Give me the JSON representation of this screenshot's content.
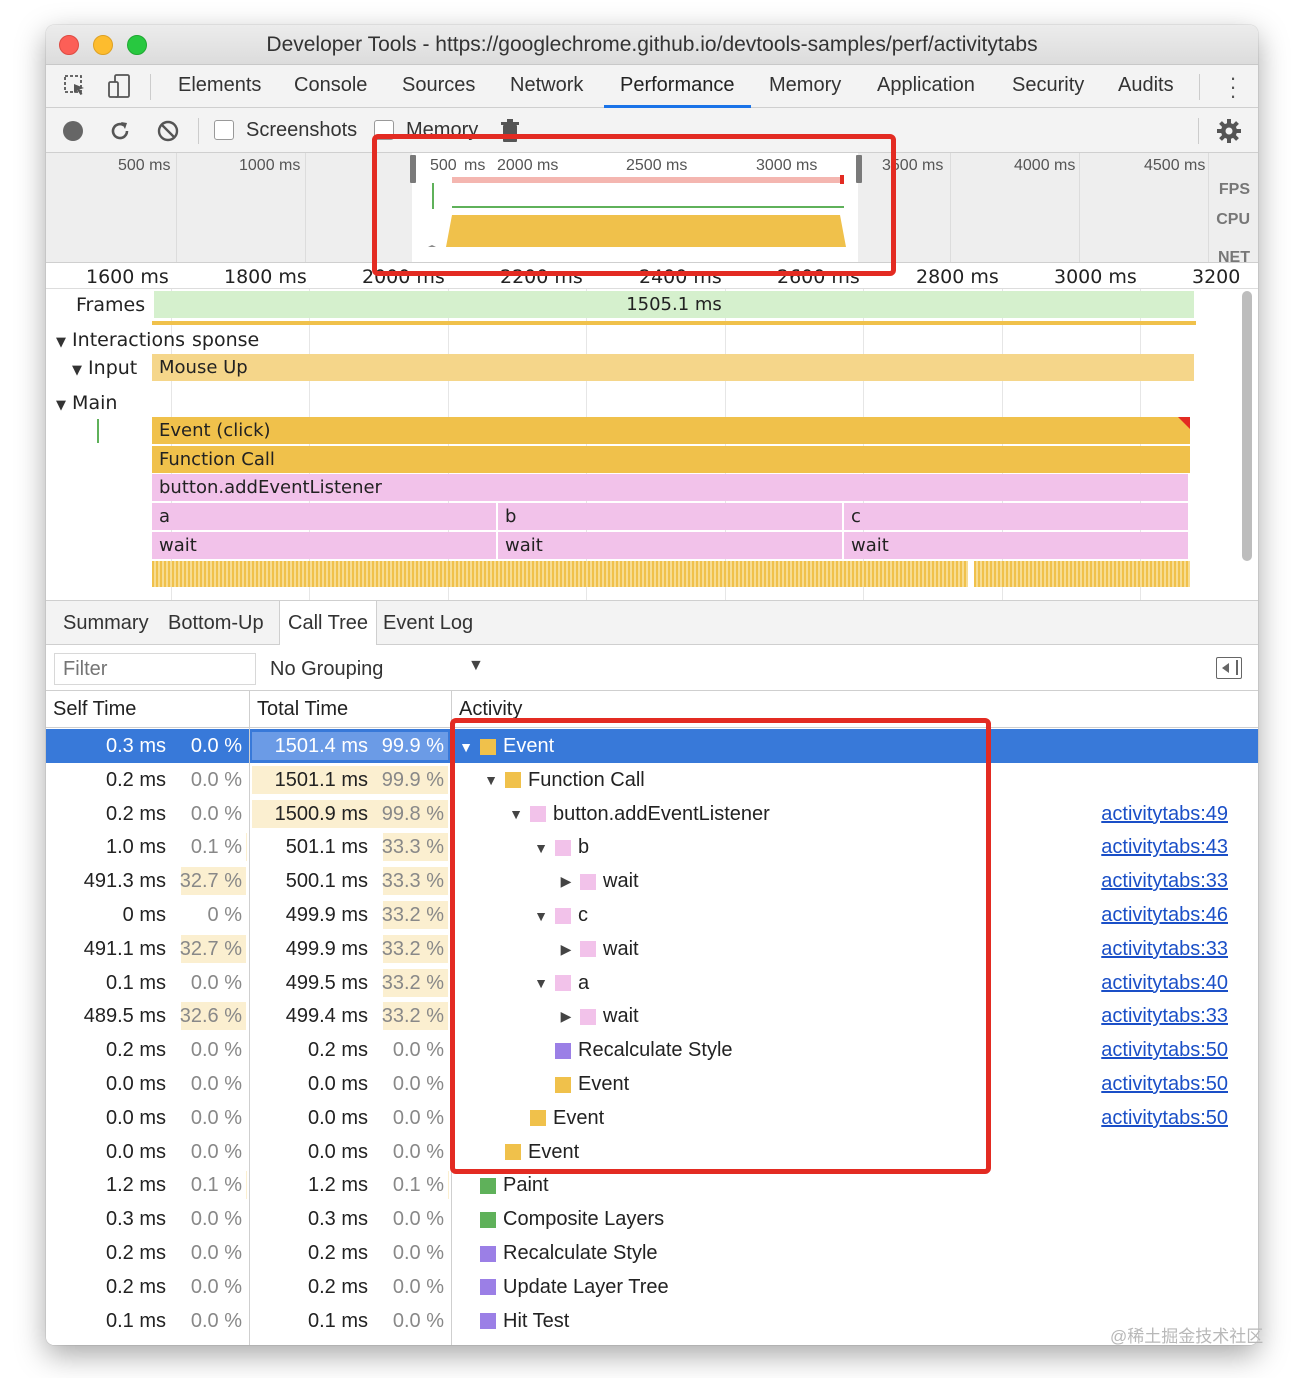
{
  "window": {
    "title": "Developer Tools - https://googlechrome.github.io/devtools-samples/perf/activitytabs"
  },
  "tabs": [
    "Elements",
    "Console",
    "Sources",
    "Network",
    "Performance",
    "Memory",
    "Application",
    "Security",
    "Audits"
  ],
  "active_tab": "Performance",
  "toolbar": {
    "screenshots_label": "Screenshots",
    "memory_label": "Memory"
  },
  "overview": {
    "ticks": [
      "500 ms",
      "1000 ms",
      "500",
      "ms",
      "2000 ms",
      "2500 ms",
      "3000 ms",
      "3500 ms",
      "4000 ms",
      "4500 ms"
    ],
    "labels": [
      "FPS",
      "CPU",
      "NET"
    ]
  },
  "flamechart": {
    "ticks": [
      "1600 ms",
      "1800 ms",
      "2000 ms",
      "2200 ms",
      "2400 ms",
      "2600 ms",
      "2800 ms",
      "3000 ms",
      "3200"
    ],
    "frames_label": "Frames",
    "frames_value": "1505.1 ms",
    "interactions_label": "Interactions",
    "interactions_overlap": "sponse",
    "input_label": "Input",
    "mouse_up": "Mouse Up",
    "main_label": "Main",
    "event_click": "Event (click)",
    "function_call": "Function Call",
    "add_listener": "button.addEventListener",
    "fn_a": "a",
    "fn_b": "b",
    "fn_c": "c",
    "wait": "wait"
  },
  "detail_tabs": [
    "Summary",
    "Bottom-Up",
    "Call Tree",
    "Event Log"
  ],
  "active_detail_tab": "Call Tree",
  "filter": {
    "placeholder": "Filter",
    "grouping": "No Grouping"
  },
  "columns": {
    "self": "Self Time",
    "total": "Total Time",
    "activity": "Activity"
  },
  "colors": {
    "scripting": "#f0c14b",
    "function": "#f2c2ea",
    "rendering": "#9b7fe6",
    "painting": "#5fb15a",
    "selection": "#3879d9"
  },
  "rows": [
    {
      "self_ms": "0.3 ms",
      "self_pct": "0.0 %",
      "self_bar": 0.0,
      "total_ms": "1501.4 ms",
      "total_pct": "99.9 %",
      "total_bar": 0.999,
      "depth": 0,
      "expander": "▼",
      "color": "#f0c14b",
      "name": "Event",
      "link": ""
    },
    {
      "self_ms": "0.2 ms",
      "self_pct": "0.0 %",
      "self_bar": 0.0,
      "total_ms": "1501.1 ms",
      "total_pct": "99.9 %",
      "total_bar": 0.999,
      "depth": 1,
      "expander": "▼",
      "color": "#f0c14b",
      "name": "Function Call",
      "link": ""
    },
    {
      "self_ms": "0.2 ms",
      "self_pct": "0.0 %",
      "self_bar": 0.0,
      "total_ms": "1500.9 ms",
      "total_pct": "99.8 %",
      "total_bar": 0.998,
      "depth": 2,
      "expander": "▼",
      "color": "#f2c2ea",
      "name": "button.addEventListener",
      "link": "activitytabs:49"
    },
    {
      "self_ms": "1.0 ms",
      "self_pct": "0.1 %",
      "self_bar": 0.001,
      "total_ms": "501.1 ms",
      "total_pct": "33.3 %",
      "total_bar": 0.333,
      "depth": 3,
      "expander": "▼",
      "color": "#f2c2ea",
      "name": "b",
      "link": "activitytabs:43"
    },
    {
      "self_ms": "491.3 ms",
      "self_pct": "32.7 %",
      "self_bar": 0.327,
      "total_ms": "500.1 ms",
      "total_pct": "33.3 %",
      "total_bar": 0.333,
      "depth": 4,
      "expander": "▶",
      "color": "#f2c2ea",
      "name": "wait",
      "link": "activitytabs:33"
    },
    {
      "self_ms": "0 ms",
      "self_pct": "0 %",
      "self_bar": 0.0,
      "total_ms": "499.9 ms",
      "total_pct": "33.2 %",
      "total_bar": 0.332,
      "depth": 3,
      "expander": "▼",
      "color": "#f2c2ea",
      "name": "c",
      "link": "activitytabs:46"
    },
    {
      "self_ms": "491.1 ms",
      "self_pct": "32.7 %",
      "self_bar": 0.327,
      "total_ms": "499.9 ms",
      "total_pct": "33.2 %",
      "total_bar": 0.332,
      "depth": 4,
      "expander": "▶",
      "color": "#f2c2ea",
      "name": "wait",
      "link": "activitytabs:33"
    },
    {
      "self_ms": "0.1 ms",
      "self_pct": "0.0 %",
      "self_bar": 0.0,
      "total_ms": "499.5 ms",
      "total_pct": "33.2 %",
      "total_bar": 0.332,
      "depth": 3,
      "expander": "▼",
      "color": "#f2c2ea",
      "name": "a",
      "link": "activitytabs:40"
    },
    {
      "self_ms": "489.5 ms",
      "self_pct": "32.6 %",
      "self_bar": 0.326,
      "total_ms": "499.4 ms",
      "total_pct": "33.2 %",
      "total_bar": 0.332,
      "depth": 4,
      "expander": "▶",
      "color": "#f2c2ea",
      "name": "wait",
      "link": "activitytabs:33"
    },
    {
      "self_ms": "0.2 ms",
      "self_pct": "0.0 %",
      "self_bar": 0.0,
      "total_ms": "0.2 ms",
      "total_pct": "0.0 %",
      "total_bar": 0.0,
      "depth": 3,
      "expander": "",
      "color": "#9b7fe6",
      "name": "Recalculate Style",
      "link": "activitytabs:50"
    },
    {
      "self_ms": "0.0 ms",
      "self_pct": "0.0 %",
      "self_bar": 0.0,
      "total_ms": "0.0 ms",
      "total_pct": "0.0 %",
      "total_bar": 0.0,
      "depth": 3,
      "expander": "",
      "color": "#f0c14b",
      "name": "Event",
      "link": "activitytabs:50"
    },
    {
      "self_ms": "0.0 ms",
      "self_pct": "0.0 %",
      "self_bar": 0.0,
      "total_ms": "0.0 ms",
      "total_pct": "0.0 %",
      "total_bar": 0.0,
      "depth": 2,
      "expander": "",
      "color": "#f0c14b",
      "name": "Event",
      "link": "activitytabs:50"
    },
    {
      "self_ms": "0.0 ms",
      "self_pct": "0.0 %",
      "self_bar": 0.0,
      "total_ms": "0.0 ms",
      "total_pct": "0.0 %",
      "total_bar": 0.0,
      "depth": 1,
      "expander": "",
      "color": "#f0c14b",
      "name": "Event",
      "link": ""
    },
    {
      "self_ms": "1.2 ms",
      "self_pct": "0.1 %",
      "self_bar": 0.001,
      "total_ms": "1.2 ms",
      "total_pct": "0.1 %",
      "total_bar": 0.001,
      "depth": 0,
      "expander": "",
      "color": "#5fb15a",
      "name": "Paint",
      "link": ""
    },
    {
      "self_ms": "0.3 ms",
      "self_pct": "0.0 %",
      "self_bar": 0.0,
      "total_ms": "0.3 ms",
      "total_pct": "0.0 %",
      "total_bar": 0.0,
      "depth": 0,
      "expander": "",
      "color": "#5fb15a",
      "name": "Composite Layers",
      "link": ""
    },
    {
      "self_ms": "0.2 ms",
      "self_pct": "0.0 %",
      "self_bar": 0.0,
      "total_ms": "0.2 ms",
      "total_pct": "0.0 %",
      "total_bar": 0.0,
      "depth": 0,
      "expander": "",
      "color": "#9b7fe6",
      "name": "Recalculate Style",
      "link": ""
    },
    {
      "self_ms": "0.2 ms",
      "self_pct": "0.0 %",
      "self_bar": 0.0,
      "total_ms": "0.2 ms",
      "total_pct": "0.0 %",
      "total_bar": 0.0,
      "depth": 0,
      "expander": "",
      "color": "#9b7fe6",
      "name": "Update Layer Tree",
      "link": ""
    },
    {
      "self_ms": "0.1 ms",
      "self_pct": "0.0 %",
      "self_bar": 0.0,
      "total_ms": "0.1 ms",
      "total_pct": "0.0 %",
      "total_bar": 0.0,
      "depth": 0,
      "expander": "",
      "color": "#9b7fe6",
      "name": "Hit Test",
      "link": ""
    }
  ],
  "watermark": "@稀土掘金技术社区"
}
